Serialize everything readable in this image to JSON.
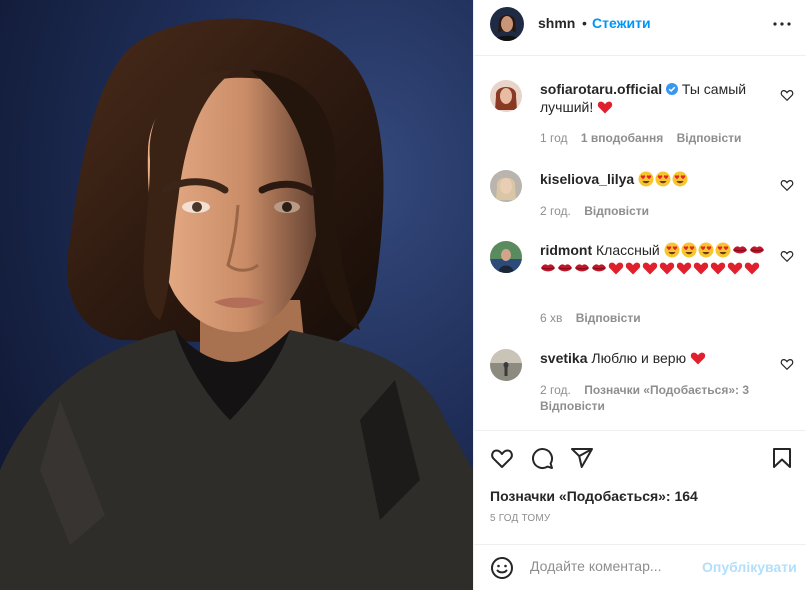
{
  "post": {
    "author": "shmn",
    "separator": "•",
    "follow_label": "Стежити",
    "photo_icon": "portrait-photo"
  },
  "comments": [
    {
      "username": "sofiarotaru.official",
      "verified": true,
      "text": "Ты самый лучший!",
      "emojis": [
        "red-heart"
      ],
      "time": "1 год",
      "likes": "1 вподобання",
      "reply": "Відповісти"
    },
    {
      "username": "kiseliova_lilya",
      "verified": false,
      "text": "",
      "emojis": [
        "heart-eyes",
        "heart-eyes",
        "heart-eyes"
      ],
      "time": "2 год.",
      "likes": "",
      "reply": "Відповісти"
    },
    {
      "username": "ridmont",
      "verified": false,
      "text": "Классный",
      "emojis": [
        "heart-eyes",
        "heart-eyes",
        "heart-eyes",
        "heart-eyes",
        "kiss-lips",
        "kiss-lips",
        "kiss-lips",
        "kiss-lips",
        "kiss-lips",
        "kiss-lips",
        "red-heart",
        "red-heart",
        "red-heart",
        "red-heart",
        "red-heart",
        "red-heart",
        "red-heart",
        "red-heart"
      ],
      "time": "6 хв",
      "likes": "",
      "reply": "Відповісти"
    },
    {
      "username": "svetika",
      "verified": false,
      "text": "Люблю и верю",
      "emojis": [
        "red-heart"
      ],
      "time": "2 год.",
      "likes": "Позначки «Подобається»: 3",
      "reply": "Відповісти"
    }
  ],
  "actions": {
    "icons": [
      "heart-icon",
      "comment-icon",
      "share-icon",
      "bookmark-icon"
    ],
    "likes_text": "Позначки «Подобається»: 164",
    "timestamp": "5 год тому"
  },
  "add_comment": {
    "placeholder": "Додайте коментар...",
    "publish_label": "Опублікувати"
  },
  "colors": {
    "link": "#0095f6",
    "publish_disabled": "#b2dffc",
    "secondary_text": "#8e8e8e",
    "border": "#efefef",
    "photo_background": "#1d2c55"
  }
}
